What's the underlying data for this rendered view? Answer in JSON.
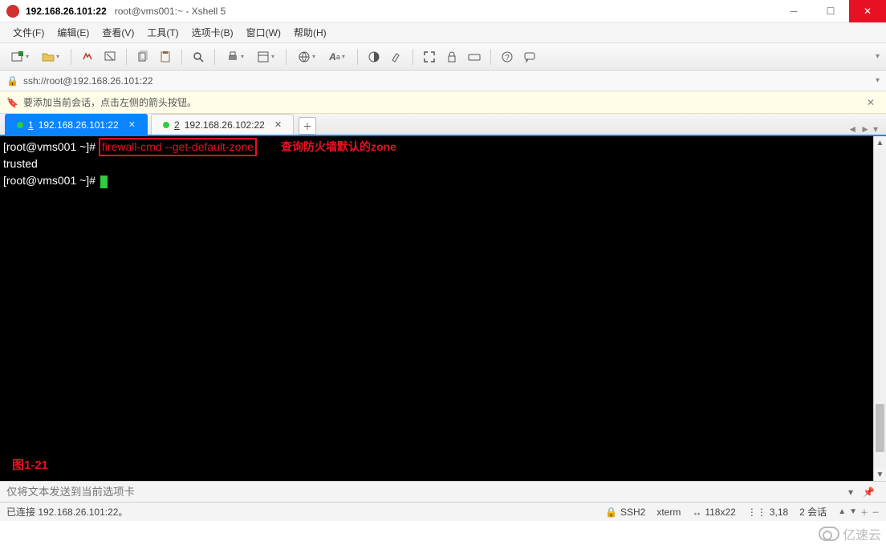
{
  "title": {
    "bold": "192.168.26.101:22",
    "rest": "root@vms001:~ - Xshell 5"
  },
  "menu": [
    "文件(F)",
    "编辑(E)",
    "查看(V)",
    "工具(T)",
    "选项卡(B)",
    "窗口(W)",
    "帮助(H)"
  ],
  "address": {
    "url": "ssh://root@192.168.26.101:22"
  },
  "hint": {
    "text": "要添加当前会话，点击左侧的箭头按钮。"
  },
  "tabs": [
    {
      "num": "1",
      "label": "192.168.26.101:22",
      "active": true
    },
    {
      "num": "2",
      "label": "192.168.26.102:22",
      "active": false
    }
  ],
  "term": {
    "prompt1": "[root@vms001 ~]# ",
    "cmd": "firewall-cmd --get-default-zone",
    "anno": "查询防火墙默认的zone",
    "output": "trusted",
    "prompt2": "[root@vms001 ~]# ",
    "figlabel": "图1-21"
  },
  "sendbar": {
    "placeholder": "仅将文本发送到当前选项卡"
  },
  "status": {
    "conn": "已连接 192.168.26.101:22。",
    "proto": "SSH2",
    "term": "xterm",
    "size": "118x22",
    "pos": "3,18",
    "sessions": "2 会话"
  },
  "watermark": "亿速云"
}
